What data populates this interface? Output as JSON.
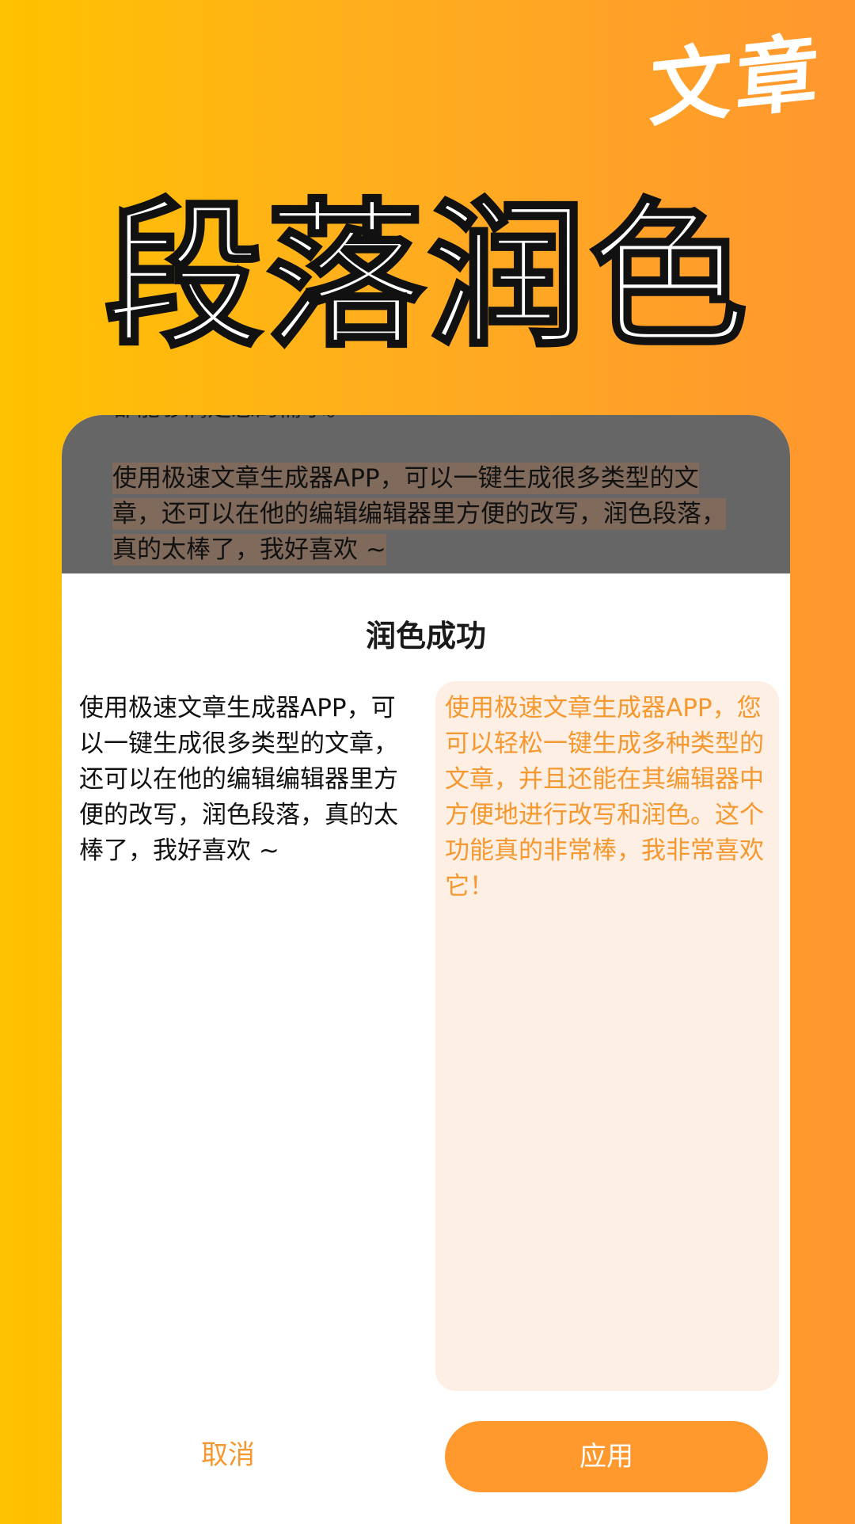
{
  "banner": {
    "corner_title": "文章",
    "hero_title": "段落润色"
  },
  "editor": {
    "cutoff_line": "都能够满足您的需求。",
    "selected_paragraph": "使用极速文章生成器APP，可以一键生成很多类型的文章，还可以在他的编辑编辑器里方便的改写，润色段落，真的太棒了，我好喜欢 ~"
  },
  "dialog": {
    "title": "润色成功",
    "original_text": "使用极速文章生成器APP，可以一键生成很多类型的文章，还可以在他的编辑编辑器里方便的改写，润色段落，真的太棒了，我好喜欢 ~",
    "polished_text": "使用极速文章生成器APP，您可以轻松一键生成多种类型的文章，并且还能在其编辑器中方便地进行改写和润色。这个功能真的非常棒，我非常喜欢它！",
    "cancel_label": "取消",
    "apply_label": "应用"
  },
  "colors": {
    "accent": "#FF992E",
    "accent_text": "#F4982F",
    "result_background": "#FDEFE3",
    "background_start": "#FFC200",
    "background_end": "#FF962F"
  }
}
